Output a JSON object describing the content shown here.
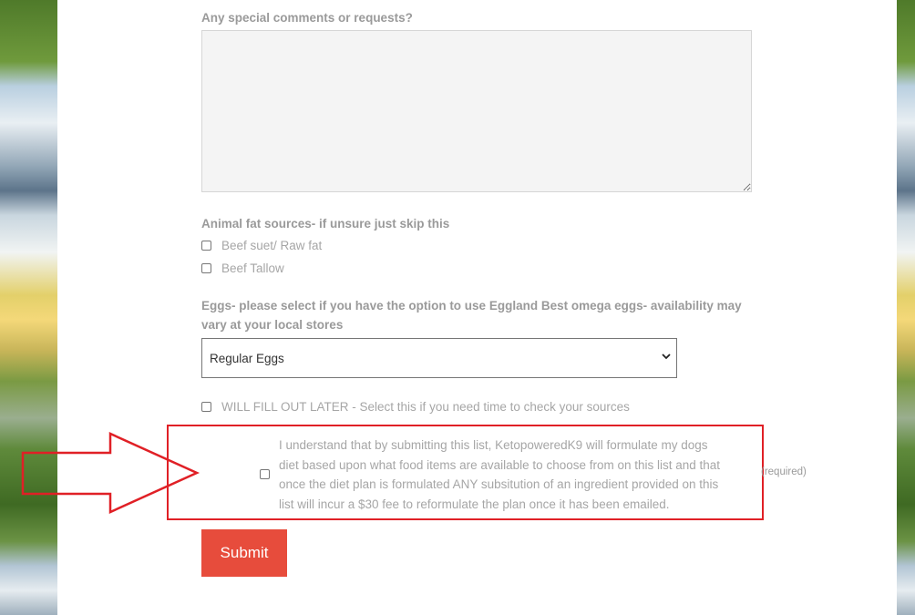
{
  "comments": {
    "label": "Any special comments or requests?",
    "value": ""
  },
  "animal_fat": {
    "label": "Animal fat sources- if unsure just skip this",
    "options": [
      {
        "label": "Beef suet/ Raw fat",
        "checked": false
      },
      {
        "label": "Beef Tallow",
        "checked": false
      }
    ]
  },
  "eggs": {
    "label_line1": "Eggs- please select if you have the option to use Eggland Best omega eggs- availability may",
    "label_line2": "vary at your local stores",
    "selected": "Regular Eggs"
  },
  "fill_later": {
    "label": "WILL FILL OUT LATER - Select this if you need time to check your sources",
    "checked": false
  },
  "consent": {
    "line1": "I understand that by submitting this list, KetopoweredK9 will formulate my dogs",
    "line2": "diet based upon what food items are available to choose from on this list and that",
    "line3": "once the diet plan is formulated ANY subsitution of an ingredient provided on this",
    "line4": "list will incur a $30 fee to reformulate the plan once it has been emailed.",
    "required_label": "(required)",
    "checked": false
  },
  "submit_label": "Submit",
  "colors": {
    "accent": "#e74c3c",
    "highlight": "#e02026",
    "label_gray": "#9a9a9a"
  }
}
